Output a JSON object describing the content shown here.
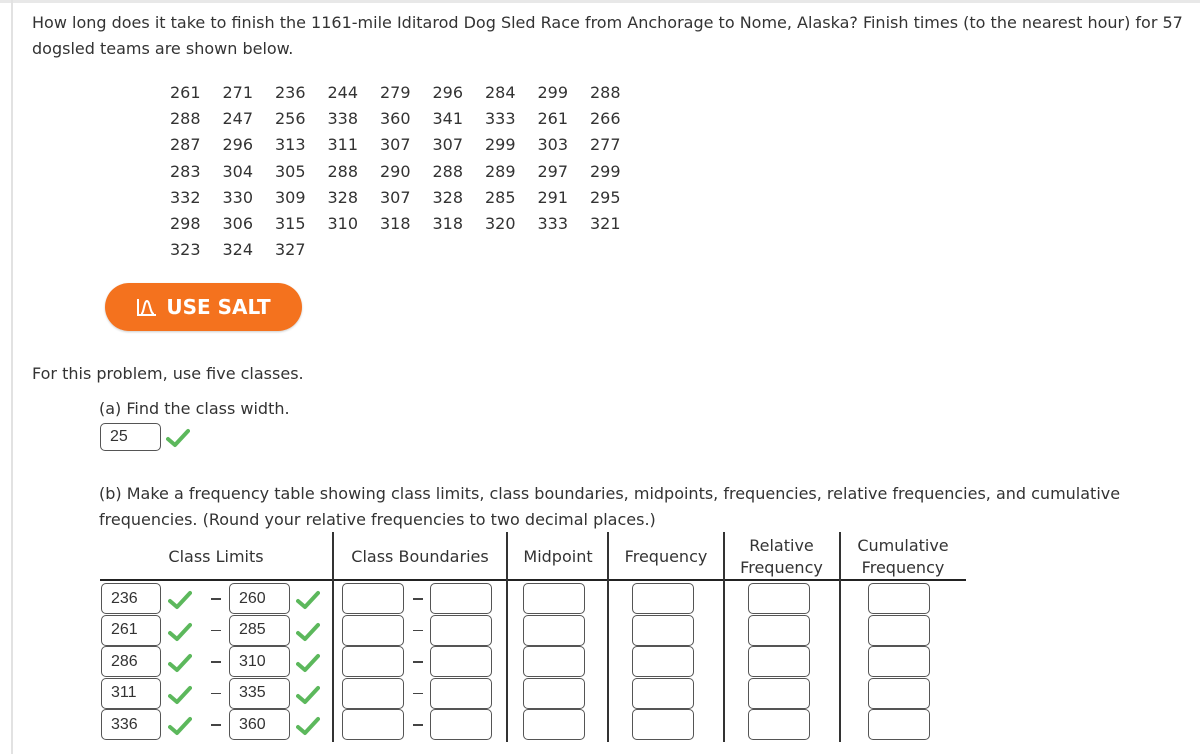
{
  "question": {
    "text": "How long does it take to finish the 1161-mile Iditarod Dog Sled Race from Anchorage to Nome, Alaska? Finish times (to the nearest hour) for 57 dogsled teams are shown below."
  },
  "finish_times": [
    [
      "261",
      "271",
      "236",
      "244",
      "279",
      "296",
      "284",
      "299",
      "288"
    ],
    [
      "288",
      "247",
      "256",
      "338",
      "360",
      "341",
      "333",
      "261",
      "266"
    ],
    [
      "287",
      "296",
      "313",
      "311",
      "307",
      "307",
      "299",
      "303",
      "277"
    ],
    [
      "283",
      "304",
      "305",
      "288",
      "290",
      "288",
      "289",
      "297",
      "299"
    ],
    [
      "332",
      "330",
      "309",
      "328",
      "307",
      "328",
      "285",
      "291",
      "295"
    ],
    [
      "298",
      "306",
      "315",
      "310",
      "318",
      "318",
      "320",
      "333",
      "321"
    ],
    [
      "323",
      "324",
      "327"
    ]
  ],
  "salt_button": {
    "label": "USE SALT",
    "icon": "salt-bell-curve-icon",
    "color": "#f4721e"
  },
  "instruction": "For this problem, use five classes.",
  "part_a": {
    "prompt": "(a) Find the class width.",
    "answer": "25",
    "status": "correct"
  },
  "part_b": {
    "prompt": "(b) Make a frequency table showing class limits, class boundaries, midpoints, frequencies, relative frequencies, and cumulative frequencies. (Round your relative frequencies to two decimal places.)",
    "headers": {
      "class_limits": "Class Limits",
      "class_boundaries": "Class Boundaries",
      "midpoint": "Midpoint",
      "frequency": "Frequency",
      "relative_line1": "Relative",
      "relative_line2": "Frequency",
      "cumulative_line1": "Cumulative",
      "cumulative_line2": "Frequency"
    },
    "rows": [
      {
        "lower": "236",
        "upper": "260",
        "lower_status": "correct",
        "upper_status": "correct",
        "boundary_lower": "",
        "boundary_upper": "",
        "midpoint": "",
        "frequency": "",
        "relative": "",
        "cumulative": ""
      },
      {
        "lower": "261",
        "upper": "285",
        "lower_status": "correct",
        "upper_status": "correct",
        "boundary_lower": "",
        "boundary_upper": "",
        "midpoint": "",
        "frequency": "",
        "relative": "",
        "cumulative": ""
      },
      {
        "lower": "286",
        "upper": "310",
        "lower_status": "correct",
        "upper_status": "correct",
        "boundary_lower": "",
        "boundary_upper": "",
        "midpoint": "",
        "frequency": "",
        "relative": "",
        "cumulative": ""
      },
      {
        "lower": "311",
        "upper": "335",
        "lower_status": "correct",
        "upper_status": "correct",
        "boundary_lower": "",
        "boundary_upper": "",
        "midpoint": "",
        "frequency": "",
        "relative": "",
        "cumulative": ""
      },
      {
        "lower": "336",
        "upper": "360",
        "lower_status": "correct",
        "upper_status": "correct",
        "boundary_lower": "",
        "boundary_upper": "",
        "midpoint": "",
        "frequency": "",
        "relative": "",
        "cumulative": ""
      }
    ],
    "separator": "–"
  },
  "colors": {
    "check_green": "#5cb85c",
    "accent_orange": "#f4721e"
  }
}
